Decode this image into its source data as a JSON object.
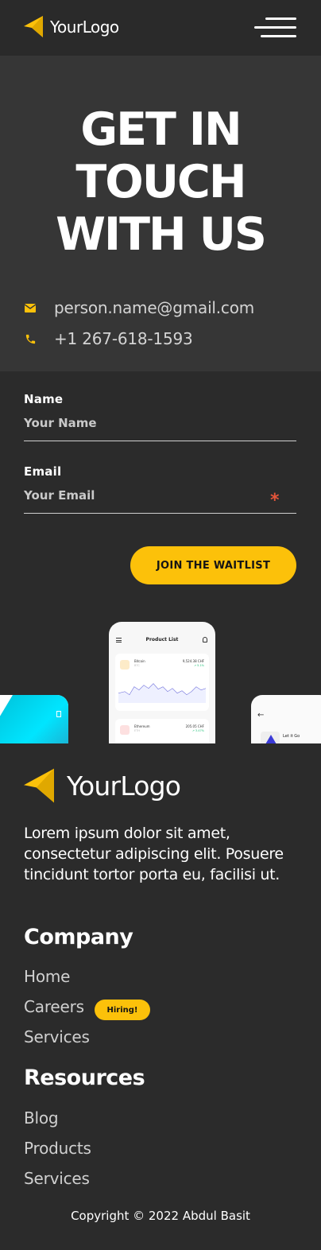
{
  "brand": {
    "name": "YourLogo",
    "accent": "#FCC10A"
  },
  "header": {
    "menu_icon": "hamburger-menu-icon"
  },
  "hero": {
    "title_lines": [
      "GET IN",
      "TOUCH",
      "WITH US"
    ],
    "email": "person.name@gmail.com",
    "phone": "+1 267-618-1593"
  },
  "form": {
    "name_label": "Name",
    "name_placeholder": "Your Name",
    "email_label": "Email",
    "email_placeholder": "Your Email",
    "required_mark": "*",
    "submit_label": "JOIN THE WAITLIST"
  },
  "mockup": {
    "title": "Product List",
    "coins": [
      {
        "name": "Bitcoin",
        "symbol": "BTC",
        "price": "9,524.38 CHF",
        "change": "↗ 5.1%"
      },
      {
        "name": "Ethereum",
        "symbol": "ETH",
        "price": "205.05 CHF",
        "change": "↗ 3.47%"
      }
    ],
    "right_label": "Let it Go"
  },
  "footer": {
    "tagline": "Lorem ipsum dolor sit amet, consectetur adipiscing elit. Posuere tincidunt tortor porta eu, facilisi ut.",
    "company": {
      "heading": "Company",
      "links": [
        "Home",
        "Careers",
        "Services"
      ],
      "badge": "Hiring!"
    },
    "resources": {
      "heading": "Resources",
      "links": [
        "Blog",
        "Products",
        "Services"
      ]
    },
    "copyright": "Copyright © 2022 Abdul Basit"
  }
}
